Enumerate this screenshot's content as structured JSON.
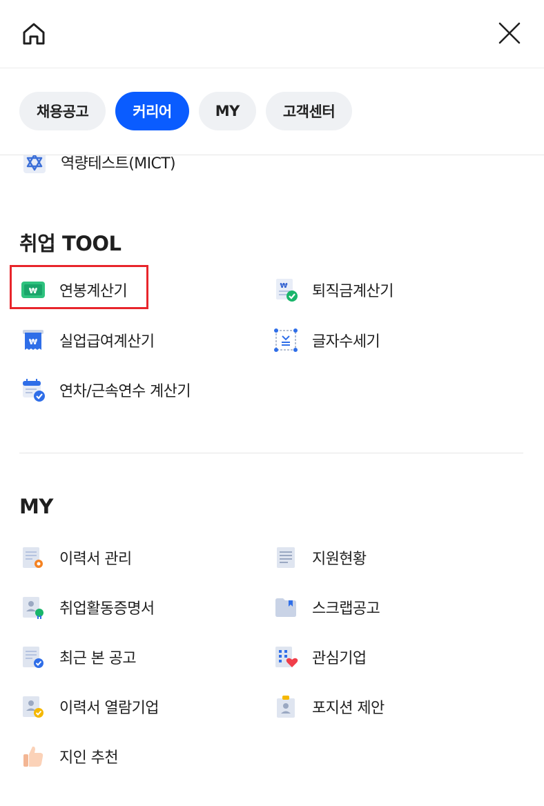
{
  "header": {
    "home_icon": "home-icon",
    "close_icon": "close-icon"
  },
  "tabs": [
    {
      "label": "채용공고",
      "active": false
    },
    {
      "label": "커리어",
      "active": true
    },
    {
      "label": "MY",
      "active": false
    },
    {
      "label": "고객센터",
      "active": false
    }
  ],
  "partial_item": {
    "label": "역량테스트(MICT)",
    "icon": "star-of-david-icon"
  },
  "tool_section": {
    "title": "취업 TOOL",
    "items": [
      {
        "label": "연봉계산기",
        "icon": "salary-calculator-icon",
        "highlighted": true
      },
      {
        "label": "퇴직금계산기",
        "icon": "severance-calculator-icon"
      },
      {
        "label": "실업급여계산기",
        "icon": "unemployment-benefit-icon"
      },
      {
        "label": "글자수세기",
        "icon": "character-count-icon"
      },
      {
        "label": "연차/근속연수 계산기",
        "icon": "annual-leave-calendar-icon"
      }
    ]
  },
  "my_section": {
    "title": "MY",
    "items": [
      {
        "label": "이력서 관리",
        "icon": "resume-settings-icon"
      },
      {
        "label": "지원현황",
        "icon": "application-status-icon"
      },
      {
        "label": "취업활동증명서",
        "icon": "certificate-icon"
      },
      {
        "label": "스크랩공고",
        "icon": "scrap-folder-icon"
      },
      {
        "label": "최근 본 공고",
        "icon": "recent-viewed-icon"
      },
      {
        "label": "관심기업",
        "icon": "favorite-company-icon"
      },
      {
        "label": "이력서 열람기업",
        "icon": "resume-viewed-company-icon"
      },
      {
        "label": "포지션 제안",
        "icon": "position-offer-icon"
      },
      {
        "label": "지인 추천",
        "icon": "thumbs-up-icon"
      }
    ]
  },
  "colors": {
    "accent": "#0a5cff",
    "highlight_border": "#e8252b",
    "tab_bg": "#eff1f4"
  }
}
